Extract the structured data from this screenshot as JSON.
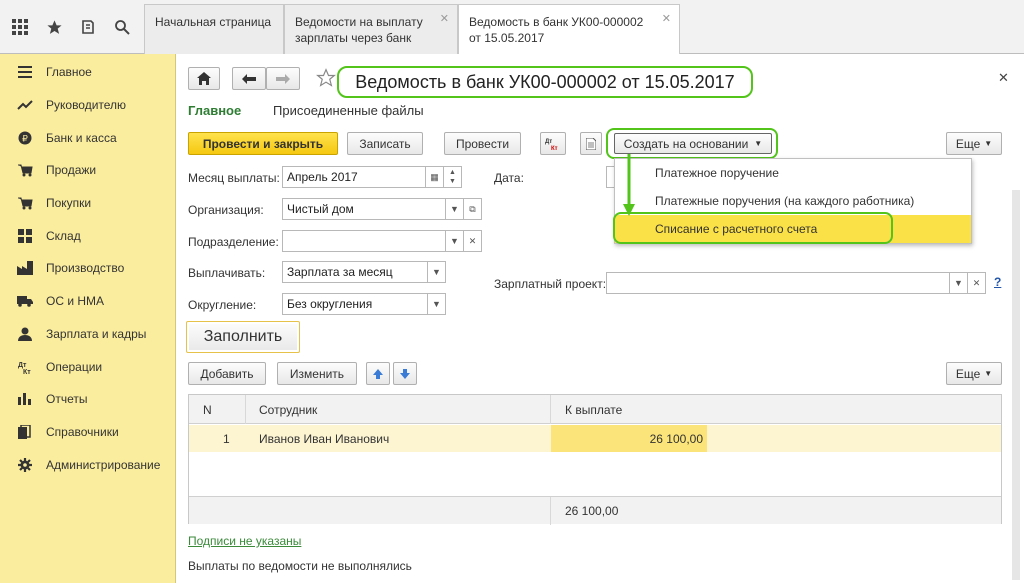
{
  "tabs": [
    {
      "line1": "Начальная страница",
      "line2": ""
    },
    {
      "line1": "Ведомости на выплату",
      "line2": "зарплаты через банк"
    },
    {
      "line1": "Ведомость в банк УК00-000002",
      "line2": "от 15.05.2017"
    }
  ],
  "sidebar": {
    "items": [
      {
        "label": "Главное",
        "icon": "menu-icon"
      },
      {
        "label": "Руководителю",
        "icon": "trend-icon"
      },
      {
        "label": "Банк и касса",
        "icon": "coin-icon"
      },
      {
        "label": "Продажи",
        "icon": "cart-icon"
      },
      {
        "label": "Покупки",
        "icon": "basket-icon"
      },
      {
        "label": "Склад",
        "icon": "warehouse-icon"
      },
      {
        "label": "Производство",
        "icon": "factory-icon"
      },
      {
        "label": "ОС и НМА",
        "icon": "truck-icon"
      },
      {
        "label": "Зарплата и кадры",
        "icon": "person-icon"
      },
      {
        "label": "Операции",
        "icon": "dt-kt-icon"
      },
      {
        "label": "Отчеты",
        "icon": "bar-chart-icon"
      },
      {
        "label": "Справочники",
        "icon": "book-icon"
      },
      {
        "label": "Администрирование",
        "icon": "gear-icon"
      }
    ]
  },
  "document": {
    "title": "Ведомость в банк УК00-000002 от 15.05.2017",
    "nav_main": "Главное",
    "nav_files": "Присоединенные файлы"
  },
  "toolbar": {
    "post_close": "Провести и закрыть",
    "save": "Записать",
    "post": "Провести",
    "create_based": "Создать на основании",
    "more": "Еще"
  },
  "dropdown": {
    "items": [
      "Платежное поручение",
      "Платежные поручения (на каждого работника)",
      "Списание с расчетного счета"
    ]
  },
  "form": {
    "month_label": "Месяц выплаты:",
    "month_value": "Апрель 2017",
    "org_label": "Организация:",
    "org_value": "Чистый дом",
    "dept_label": "Подразделение:",
    "dept_value": "",
    "pay_label": "Выплачивать:",
    "pay_value": "Зарплата за месяц",
    "round_label": "Округление:",
    "round_value": "Без округления",
    "date_label": "Дата:",
    "project_label": "Зарплатный проект:",
    "project_value": "",
    "help": "?"
  },
  "fill_button": "Заполнить",
  "table_toolbar": {
    "add": "Добавить",
    "edit": "Изменить",
    "more": "Еще"
  },
  "table": {
    "headers": [
      "N",
      "Сотрудник",
      "К выплате"
    ],
    "rows": [
      {
        "n": "1",
        "employee": "Иванов Иван Иванович",
        "amount": "26 100,00"
      }
    ],
    "total": "26 100,00"
  },
  "footer": {
    "signatures_link": "Подписи не указаны",
    "status": "Выплаты по ведомости не выполнялись"
  }
}
